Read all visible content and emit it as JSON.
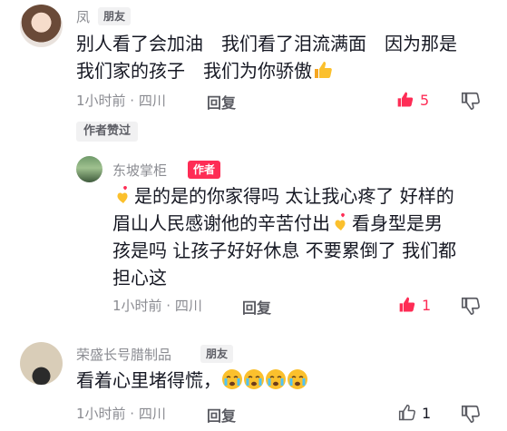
{
  "comments": [
    {
      "username": "凤",
      "badge": "朋友",
      "line1": "别人看了会加油　我们看了泪流满面　因为那是",
      "line2": "我们家的孩子　我们为你骄傲",
      "time_location": "1小时前 · 四川",
      "reply_label": "回复",
      "like_count": "5",
      "author_liked_label": "作者赞过"
    },
    {
      "username": "东坡掌柜",
      "badge": "作者",
      "line1": "是的是的你家得吗 太让我心疼了 好样的",
      "line2a": "眉山人民感谢他的辛苦付出",
      "line2b": "看身型是男",
      "line3": "孩是吗 让孩子好好休息 不要累倒了 我们都",
      "line4": "担心这",
      "time_location": "1小时前 · 四川",
      "reply_label": "回复",
      "like_count": "1"
    },
    {
      "username": "荣盛长号腊制品",
      "badge": "朋友",
      "line1": "看着心里堵得慌，",
      "time_location": "1小时前 · 四川",
      "reply_label": "回复",
      "like_count": "1"
    }
  ],
  "colors": {
    "accent": "#fe2c55",
    "muted": "#8a8b91"
  },
  "icons": [
    "thumbs-up-icon",
    "heart-hand-icon",
    "crying-face-icon",
    "like-icon",
    "dislike-icon"
  ]
}
